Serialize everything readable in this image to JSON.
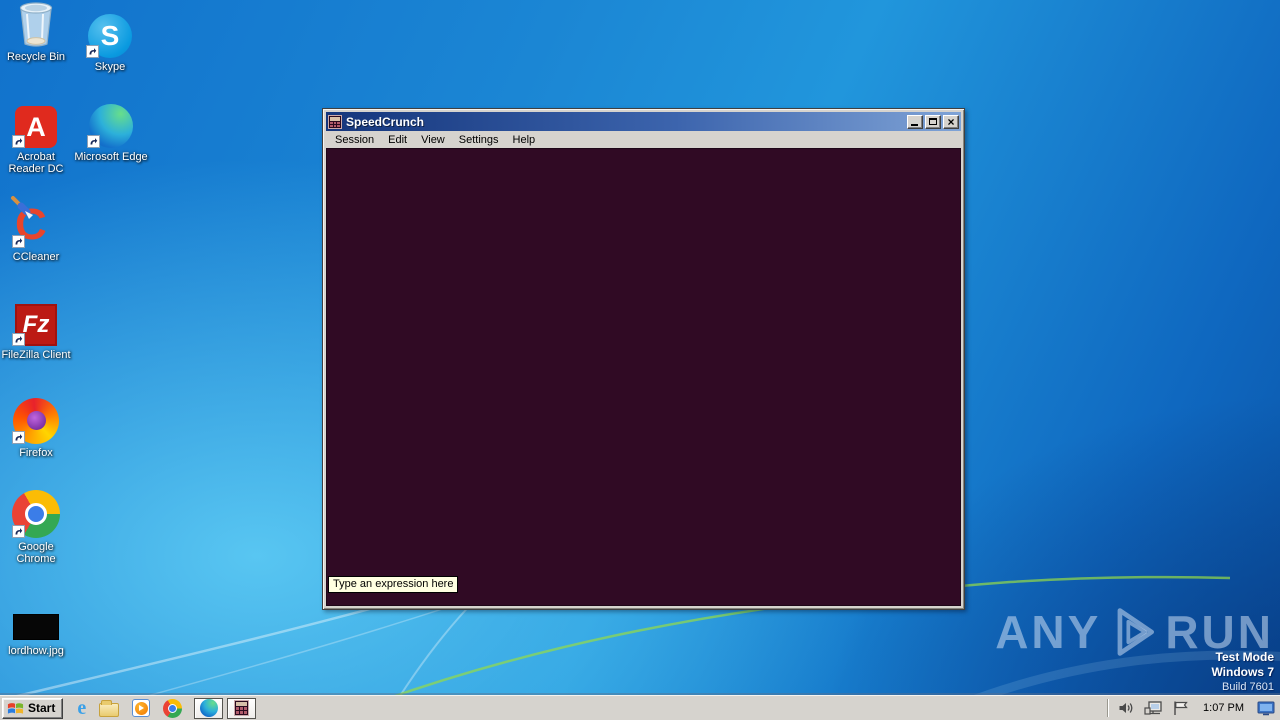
{
  "desktop": {
    "icons": [
      {
        "name": "recycle-bin",
        "label": "Recycle Bin"
      },
      {
        "name": "skype",
        "label": "Skype"
      },
      {
        "name": "acrobat-reader",
        "label": "Acrobat\nReader DC"
      },
      {
        "name": "microsoft-edge",
        "label": "Microsoft Edge"
      },
      {
        "name": "ccleaner",
        "label": "CCleaner"
      },
      {
        "name": "filezilla",
        "label": "FileZilla Client"
      },
      {
        "name": "firefox",
        "label": "Firefox"
      },
      {
        "name": "google-chrome",
        "label": "Google\nChrome"
      },
      {
        "name": "lordhow-jpg",
        "label": "lordhow.jpg"
      }
    ]
  },
  "window": {
    "title": "SpeedCrunch",
    "menu": [
      {
        "label": "Session"
      },
      {
        "label": "Edit"
      },
      {
        "label": "View"
      },
      {
        "label": "Settings"
      },
      {
        "label": "Help"
      }
    ],
    "placeholder": "Type an expression here",
    "colors": {
      "titlebar_left": "#15367c",
      "titlebar_right": "#7fa3d6",
      "content_bg": "#300a24",
      "chrome_bg": "#d6d3ce",
      "tooltip_bg": "#ffffe1"
    }
  },
  "watermark": {
    "brand_left": "ANY",
    "brand_right": "RUN",
    "mode": "Test Mode",
    "os": "Windows 7",
    "build": "Build 7601"
  },
  "taskbar": {
    "start_label": "Start",
    "quick_launch": [
      {
        "name": "internet-explorer"
      },
      {
        "name": "windows-explorer"
      },
      {
        "name": "windows-media-player"
      },
      {
        "name": "google-chrome"
      }
    ],
    "app_buttons": [
      {
        "name": "microsoft-edge"
      },
      {
        "name": "speedcrunch"
      }
    ],
    "tray": {
      "clock": "1:07 PM",
      "icons": [
        {
          "name": "volume"
        },
        {
          "name": "network"
        },
        {
          "name": "action-center-flag"
        },
        {
          "name": "display"
        }
      ]
    }
  }
}
